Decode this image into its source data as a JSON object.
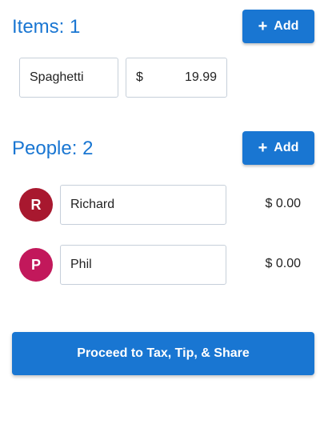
{
  "items_section": {
    "title": "Items: 1",
    "add_label": "Add",
    "items": [
      {
        "name": "Spaghetti",
        "currency": "$",
        "price": "19.99"
      }
    ]
  },
  "people_section": {
    "title": "People: 2",
    "add_label": "Add",
    "people": [
      {
        "initial": "R",
        "name": "Richard",
        "amount": "$ 0.00",
        "avatar_color": "#a8182f"
      },
      {
        "initial": "P",
        "name": "Phil",
        "amount": "$ 0.00",
        "avatar_color": "#c2185b"
      }
    ]
  },
  "proceed_label": "Proceed to Tax, Tip, & Share",
  "colors": {
    "accent": "#1976d2"
  }
}
